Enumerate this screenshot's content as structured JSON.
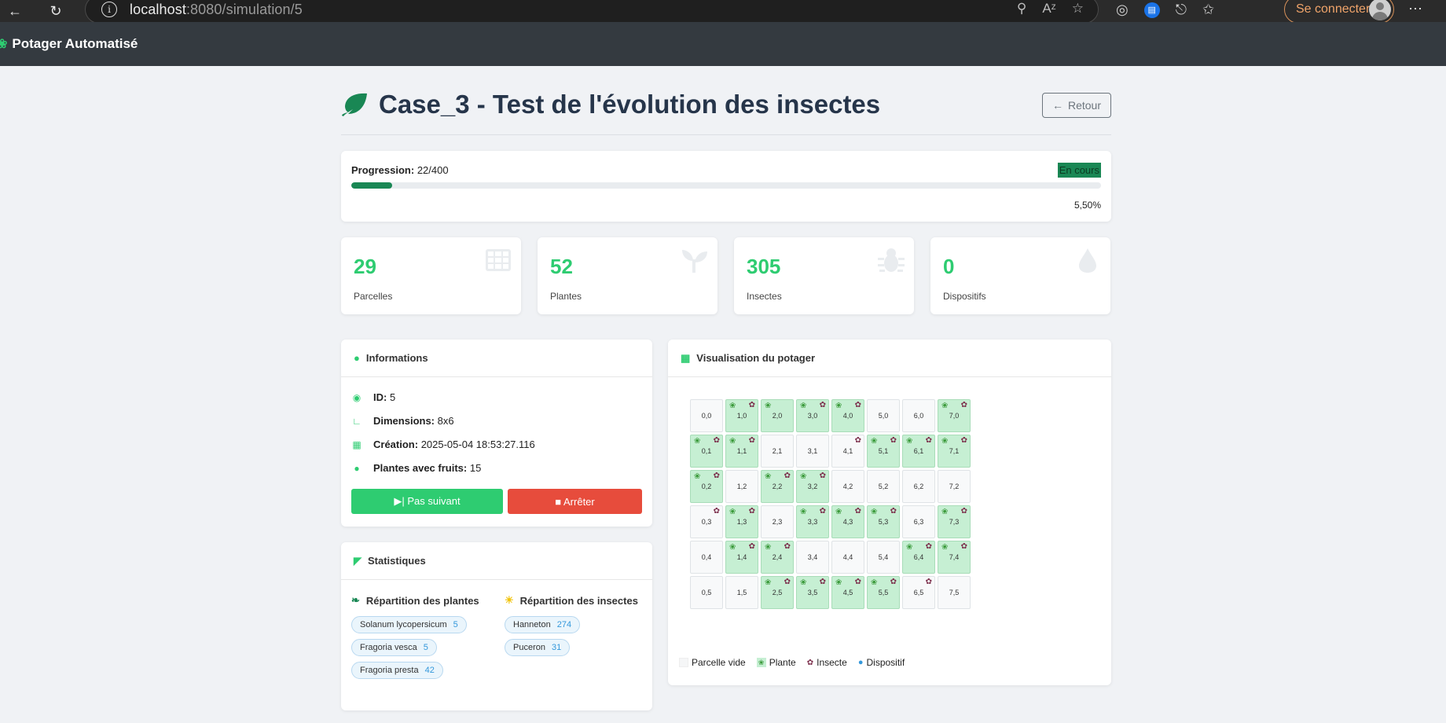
{
  "browser": {
    "url_host": "localhost",
    "url_rest": ":8080/simulation/5",
    "signin_label": "Se connecter"
  },
  "app": {
    "brand": "Potager Automatisé"
  },
  "header": {
    "title": "Case_3 - Test de l'évolution des insectes",
    "back_label": "Retour"
  },
  "progress": {
    "label": "Progression:",
    "value_text": "22/400",
    "status": "En cours",
    "percent_text": "5,50%",
    "fraction": 0.055
  },
  "stats": [
    {
      "value": "29",
      "label": "Parcelles",
      "icon": "grid-icon"
    },
    {
      "value": "52",
      "label": "Plantes",
      "icon": "seedling-icon"
    },
    {
      "value": "305",
      "label": "Insectes",
      "icon": "bug-icon"
    },
    {
      "value": "0",
      "label": "Dispositifs",
      "icon": "drop-icon"
    }
  ],
  "info": {
    "title": "Informations",
    "rows": [
      {
        "label": "ID:",
        "value": "5",
        "icon": "fingerprint-icon"
      },
      {
        "label": "Dimensions:",
        "value": "8x6",
        "icon": "ruler-icon"
      },
      {
        "label": "Création:",
        "value": "2025-05-04 18:53:27.116",
        "icon": "calendar-icon"
      },
      {
        "label": "Plantes avec fruits:",
        "value": "15",
        "icon": "apple-icon"
      }
    ],
    "next_label": "Pas suivant",
    "stop_label": "Arrêter"
  },
  "statistics": {
    "title": "Statistiques",
    "plants_title": "Répartition des plantes",
    "insects_title": "Répartition des insectes",
    "plants": [
      {
        "name": "Solanum lycopersicum",
        "count": "5"
      },
      {
        "name": "Fragoria vesca",
        "count": "5"
      },
      {
        "name": "Fragoria presta",
        "count": "42"
      }
    ],
    "insects": [
      {
        "name": "Hanneton",
        "count": "274"
      },
      {
        "name": "Puceron",
        "count": "31"
      }
    ]
  },
  "viz": {
    "title": "Visualisation du potager",
    "rows": [
      [
        {
          "l": "0,0",
          "p": 0,
          "i": 0
        },
        {
          "l": "1,0",
          "p": 1,
          "i": 1
        },
        {
          "l": "2,0",
          "p": 1,
          "i": 0
        },
        {
          "l": "3,0",
          "p": 1,
          "i": 1
        },
        {
          "l": "4,0",
          "p": 1,
          "i": 1
        },
        {
          "l": "5,0",
          "p": 0,
          "i": 0
        },
        {
          "l": "6,0",
          "p": 0,
          "i": 0
        },
        {
          "l": "7,0",
          "p": 1,
          "i": 1
        }
      ],
      [
        {
          "l": "0,1",
          "p": 1,
          "i": 1
        },
        {
          "l": "1,1",
          "p": 1,
          "i": 1
        },
        {
          "l": "2,1",
          "p": 0,
          "i": 0
        },
        {
          "l": "3,1",
          "p": 0,
          "i": 0
        },
        {
          "l": "4,1",
          "p": 0,
          "i": 1
        },
        {
          "l": "5,1",
          "p": 1,
          "i": 1
        },
        {
          "l": "6,1",
          "p": 1,
          "i": 1
        },
        {
          "l": "7,1",
          "p": 1,
          "i": 1
        }
      ],
      [
        {
          "l": "0,2",
          "p": 1,
          "i": 1
        },
        {
          "l": "1,2",
          "p": 0,
          "i": 0
        },
        {
          "l": "2,2",
          "p": 1,
          "i": 1
        },
        {
          "l": "3,2",
          "p": 1,
          "i": 1
        },
        {
          "l": "4,2",
          "p": 0,
          "i": 0
        },
        {
          "l": "5,2",
          "p": 0,
          "i": 0
        },
        {
          "l": "6,2",
          "p": 0,
          "i": 0
        },
        {
          "l": "7,2",
          "p": 0,
          "i": 0
        }
      ],
      [
        {
          "l": "0,3",
          "p": 0,
          "i": 1
        },
        {
          "l": "1,3",
          "p": 1,
          "i": 1
        },
        {
          "l": "2,3",
          "p": 0,
          "i": 0
        },
        {
          "l": "3,3",
          "p": 1,
          "i": 1
        },
        {
          "l": "4,3",
          "p": 1,
          "i": 1
        },
        {
          "l": "5,3",
          "p": 1,
          "i": 1
        },
        {
          "l": "6,3",
          "p": 0,
          "i": 0
        },
        {
          "l": "7,3",
          "p": 1,
          "i": 1
        }
      ],
      [
        {
          "l": "0,4",
          "p": 0,
          "i": 0
        },
        {
          "l": "1,4",
          "p": 1,
          "i": 1
        },
        {
          "l": "2,4",
          "p": 1,
          "i": 1
        },
        {
          "l": "3,4",
          "p": 0,
          "i": 0
        },
        {
          "l": "4,4",
          "p": 0,
          "i": 0
        },
        {
          "l": "5,4",
          "p": 0,
          "i": 0
        },
        {
          "l": "6,4",
          "p": 1,
          "i": 1
        },
        {
          "l": "7,4",
          "p": 1,
          "i": 1
        }
      ],
      [
        {
          "l": "0,5",
          "p": 0,
          "i": 0
        },
        {
          "l": "1,5",
          "p": 0,
          "i": 0
        },
        {
          "l": "2,5",
          "p": 1,
          "i": 1
        },
        {
          "l": "3,5",
          "p": 1,
          "i": 1
        },
        {
          "l": "4,5",
          "p": 1,
          "i": 1
        },
        {
          "l": "5,5",
          "p": 1,
          "i": 1
        },
        {
          "l": "6,5",
          "p": 0,
          "i": 1
        },
        {
          "l": "7,5",
          "p": 0,
          "i": 0
        }
      ]
    ],
    "legend": {
      "empty": "Parcelle vide",
      "plant": "Plante",
      "insect": "Insecte",
      "device": "Dispositif"
    }
  },
  "colors": {
    "accent": "#2ecc71",
    "danger": "#e74c3c",
    "progress": "#198754",
    "navbar": "#343a40"
  }
}
